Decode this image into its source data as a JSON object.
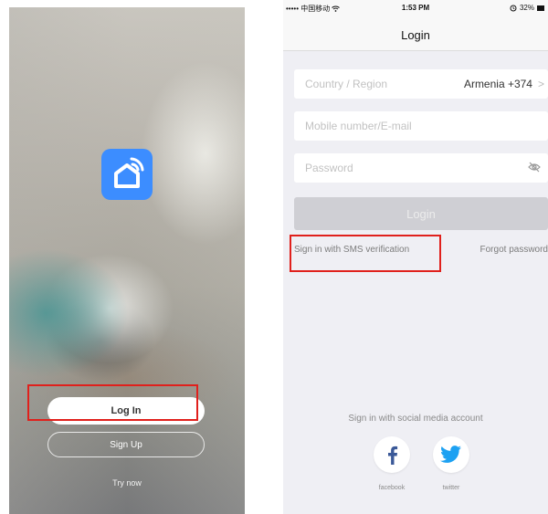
{
  "left": {
    "login_label": "Log In",
    "signup_label": "Sign Up",
    "try_now_label": "Try now"
  },
  "right": {
    "status_bar": {
      "carrier": "••••• 中国移动 ",
      "time": "1:53 PM",
      "battery": "32%"
    },
    "nav_title": "Login",
    "country_placeholder": "Country / Region",
    "country_value": "Armenia +374",
    "mobile_placeholder": "Mobile number/E-mail",
    "password_placeholder": "Password",
    "login_button": "Login",
    "sms_link": "Sign in with SMS verification",
    "forgot_link": "Forgot password",
    "social_title": "Sign in with social media account",
    "social": [
      {
        "label": "facebook",
        "icon": "facebook-icon"
      },
      {
        "label": "twitter",
        "icon": "twitter-icon"
      }
    ]
  },
  "colors": {
    "accent": "#3c8dff",
    "highlight": "#e0201c",
    "facebook": "#3b5998",
    "twitter": "#1da1f2"
  }
}
